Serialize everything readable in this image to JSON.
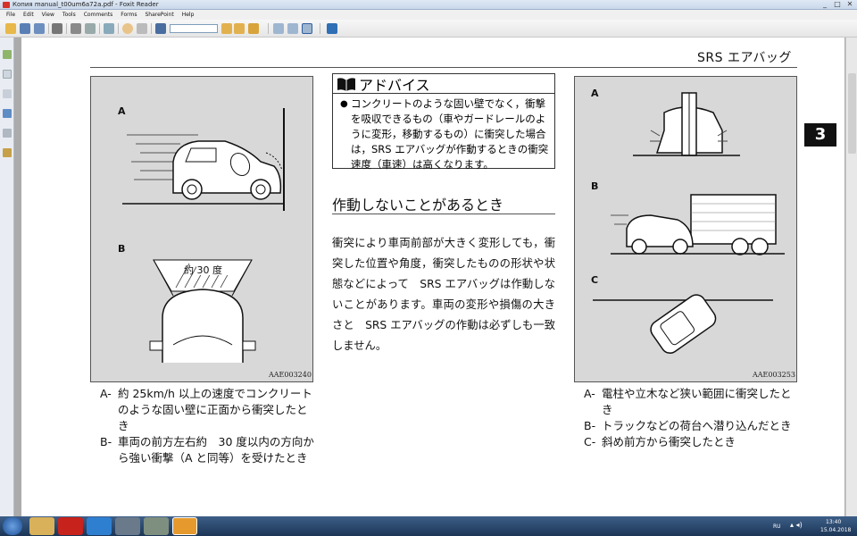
{
  "window": {
    "title": "Копия manual_t00um6a72a.pdf - Foxit Reader",
    "controls": [
      "_",
      "□",
      "✕"
    ]
  },
  "menu": [
    "File",
    "Edit",
    "View",
    "Tools",
    "Comments",
    "Forms",
    "SharePoint",
    "Help"
  ],
  "page": {
    "header": "SRS エアバッグ",
    "chapter": "3",
    "left_figure": {
      "label_a": "A",
      "label_b": "B",
      "angle_text": "約 30 度",
      "code": "AAE003240"
    },
    "left_caption": [
      {
        "key": "A-",
        "text": "約 25km/h 以上の速度でコンクリートのような固い壁に正面から衝突したとき"
      },
      {
        "key": "B-",
        "text": "車両の前方左右約　30 度以内の方向から強い衝撃（A と同等）を受けたとき"
      }
    ],
    "advice": {
      "title": "アドバイス",
      "bullet": "●",
      "text": "コンクリートのような固い壁でなく，衝撃を吸収できるもの（車やガードレールのように変形，移動するもの）に衝突した場合は，SRS エアバッグが作動するときの衝突速度（車速）は高くなります。"
    },
    "section_title": "作動しないことがあるとき",
    "paragraph": "衝突により車両前部が大きく変形しても，衝突した位置や角度，衝突したものの形状や状態などによって　SRS エアバッグは作動しないことがあります。車両の変形や損傷の大きさと　SRS エアバッグの作動は必ずしも一致しません。",
    "right_figure": {
      "label_a": "A",
      "label_b": "B",
      "label_c": "C",
      "code": "AAE003253"
    },
    "right_caption": [
      {
        "key": "A-",
        "text": "電柱や立木など狭い範囲に衝突したとき"
      },
      {
        "key": "B-",
        "text": "トラックなどの荷台へ潜り込んだとき"
      },
      {
        "key": "C-",
        "text": "斜め前方から衝突したとき"
      }
    ]
  },
  "taskbar": {
    "language": "RU",
    "time": "13:40",
    "date": "15.04.2018"
  }
}
